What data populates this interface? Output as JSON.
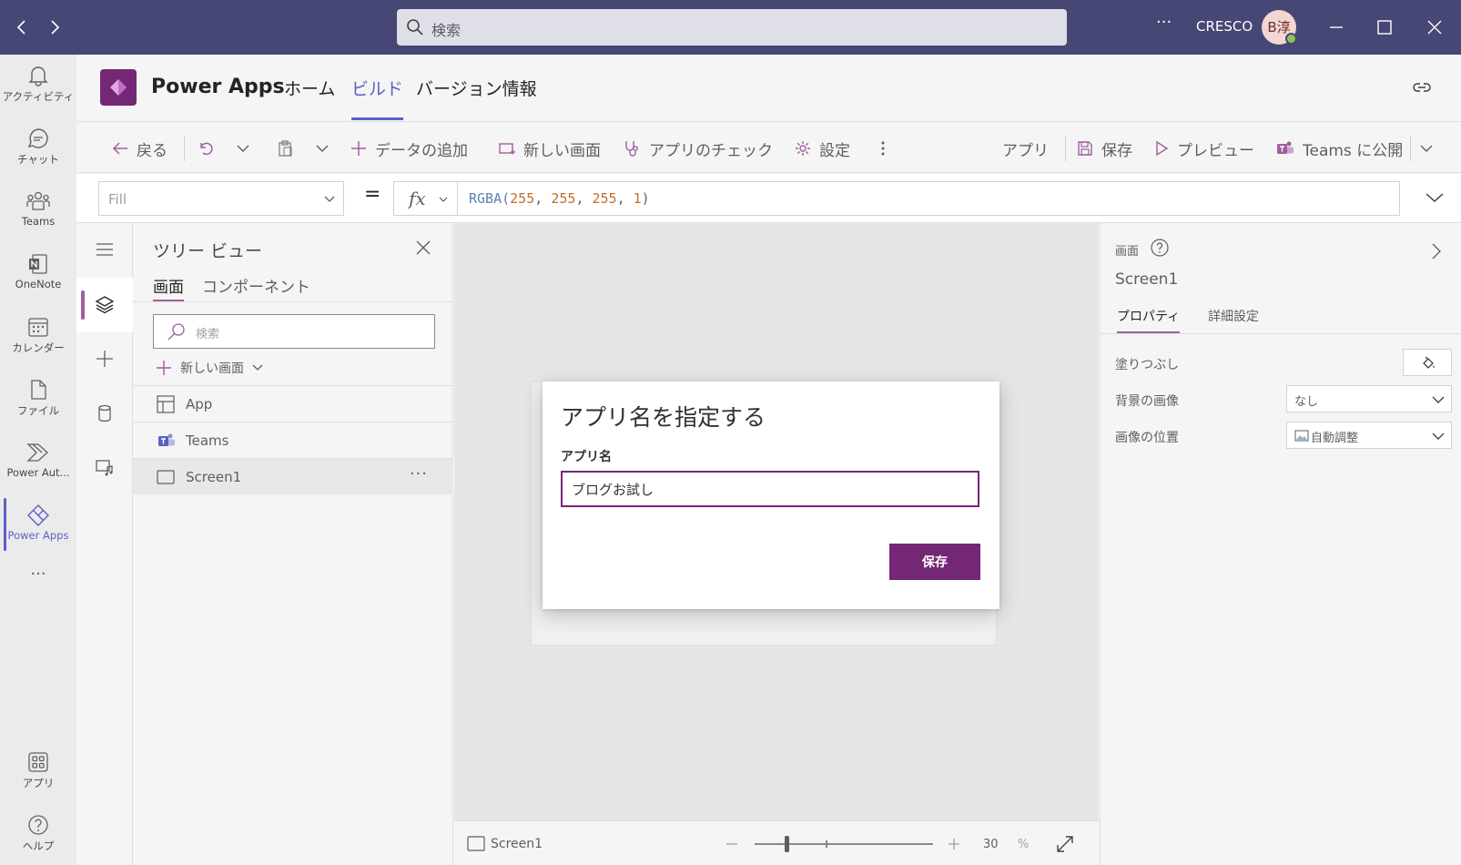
{
  "titlebar": {
    "search_placeholder": "検索",
    "more_label": "···",
    "org": "CRESCO",
    "avatar_initials": "B淳"
  },
  "rail": {
    "items": [
      {
        "label": "アクティビティ",
        "icon": "bell-icon"
      },
      {
        "label": "チャット",
        "icon": "chat-icon"
      },
      {
        "label": "Teams",
        "icon": "teams-icon"
      },
      {
        "label": "OneNote",
        "icon": "onenote-icon"
      },
      {
        "label": "カレンダー",
        "icon": "calendar-icon"
      },
      {
        "label": "ファイル",
        "icon": "file-icon"
      },
      {
        "label": "Power Aut...",
        "icon": "power-automate-icon"
      },
      {
        "label": "Power Apps",
        "icon": "power-apps-icon"
      }
    ],
    "more_label": "···",
    "bottom": [
      {
        "label": "アプリ",
        "icon": "apps-icon"
      },
      {
        "label": "ヘルプ",
        "icon": "help-icon"
      }
    ]
  },
  "app_header": {
    "title": "Power Apps",
    "tabs": [
      "ホーム",
      "ビルド",
      "バージョン情報"
    ],
    "active_tab": "ビルド"
  },
  "toolbar": {
    "back": "戻る",
    "add_data": "データの追加",
    "new_screen": "新しい画面",
    "app_check": "アプリのチェック",
    "settings": "設定",
    "app": "アプリ",
    "save": "保存",
    "preview": "プレビュー",
    "publish": "Teams に公開"
  },
  "formula_bar": {
    "property": "Fill",
    "equals": "=",
    "fx": "fx",
    "formula_fn": "RGBA(",
    "formula_args": [
      "255",
      "255",
      "255",
      "1"
    ],
    "formula_close": ")"
  },
  "tree_view": {
    "title": "ツリー ビュー",
    "tabs": [
      "画面",
      "コンポーネント"
    ],
    "search_placeholder": "検索",
    "new_screen": "新しい画面",
    "rows": [
      {
        "label": "App",
        "icon": "app-icon"
      },
      {
        "label": "Teams",
        "icon": "teams-icon"
      },
      {
        "label": "Screen1",
        "icon": "screen-icon"
      }
    ],
    "row_more": "···"
  },
  "dialog": {
    "title": "アプリ名を指定する",
    "field_label": "アプリ名",
    "field_value": "ブログお試し",
    "save_label": "保存"
  },
  "canvas_footer": {
    "screen_name": "Screen1",
    "zoom_value": "30",
    "zoom_unit": "%",
    "zoom_level": 0.3
  },
  "right_panel": {
    "section_label": "画面",
    "screen_name": "Screen1",
    "tabs": [
      "プロパティ",
      "詳細設定"
    ],
    "props": [
      {
        "label": "塗りつぶし"
      },
      {
        "label": "背景の画像",
        "value": "なし"
      },
      {
        "label": "画像の位置",
        "value": "自動調整"
      }
    ]
  },
  "colors": {
    "titlebar": "#464775",
    "accent_teams": "#5b5fc7",
    "accent_powerapps": "#742774"
  }
}
